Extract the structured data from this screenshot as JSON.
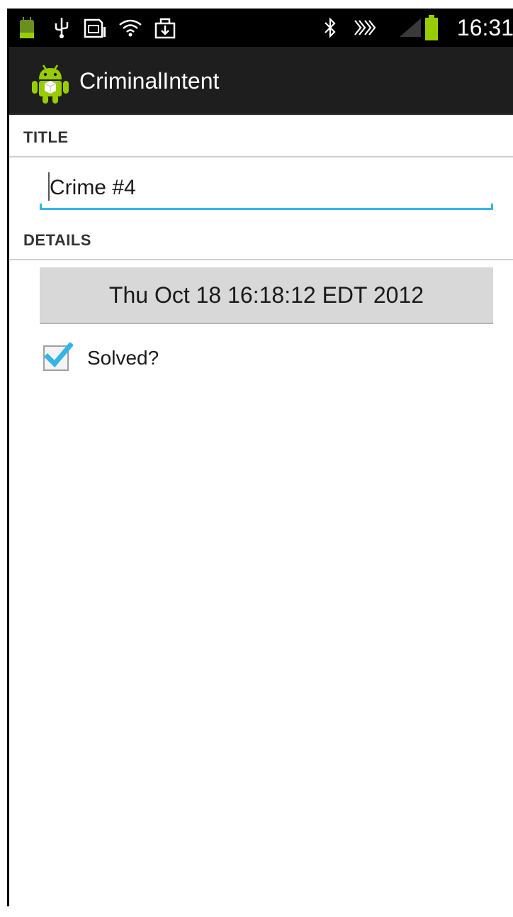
{
  "status_bar": {
    "time": "16:31",
    "icons": [
      "android-debug-icon",
      "usb-icon",
      "sd-card-icon",
      "wifi-icon",
      "download-icon",
      "bluetooth-icon",
      "nfc-icon",
      "signal-icon",
      "battery-icon"
    ],
    "accent": "#99cc00"
  },
  "action_bar": {
    "app_icon": "android-robot-icon",
    "title": "CriminalIntent"
  },
  "form": {
    "title_header": "TITLE",
    "title_value": "Crime #4",
    "details_header": "DETAILS",
    "date_label": "Thu Oct 18 16:18:12 EDT 2012",
    "solved_label": "Solved?",
    "solved_checked": true
  },
  "colors": {
    "holo_blue": "#33b5e5",
    "android_green": "#99cc00",
    "button_gray": "#d8d8d8"
  }
}
